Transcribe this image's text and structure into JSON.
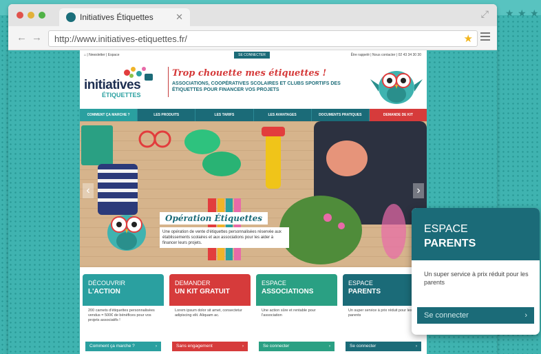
{
  "browser": {
    "tab_title": "Initiatives Étiquettes",
    "url": "http://www.initiatives-etiquettes.fr/"
  },
  "site": {
    "util_left": "| Newsletter | Espace",
    "util_connect": "SE CONNECTER",
    "util_right": "Être rappelé | Nous contacter | 02 43 34 30 30",
    "logo_main": "initiatives",
    "logo_sub": "ÉTIQUETTES",
    "tagline": "Trop chouette mes étiquettes !",
    "headline": "ASSOCIATIONS, COOPÉRATIVES SCOLAIRES ET CLUBS SPORTIFS DES ÉTIQUETTES POUR FINANCER VOS PROJETS",
    "nav": [
      "COMMENT ÇA MARCHE ?",
      "LES PRODUITS",
      "LES TARIFS",
      "LES AVANTAGES",
      "DOCUMENTS PRATIQUES",
      "DEMANDE DE KIT"
    ],
    "hero": {
      "title": "Opération Étiquettes",
      "text": "Une opération de vente d'étiquettes personnalisées réservée aux établissements scolaires et aux associations pour les aider à financer leurs projets."
    },
    "cards": [
      {
        "h1": "DÉCOUVRIR",
        "h2": "L'ACTION",
        "body": "200 carnets d'étiquettes personnalisées vendus = 500€ de bénéfices pour vos projets associatifs !",
        "button": "Comment ça marche ?",
        "color": "#2aa0a0"
      },
      {
        "h1": "DEMANDER",
        "h2": "UN KIT GRATUIT",
        "body": "Lorem ipsum dolor sit amet, consectetur adipiscing elit. Aliquam ac.",
        "button": "Sans engagement",
        "color": "#d63b3b"
      },
      {
        "h1": "ESPACE",
        "h2": "ASSOCIATIONS",
        "body": "Une action sûre et rentable pour l'association",
        "button": "Se connecter",
        "color": "#2aa083"
      },
      {
        "h1": "ESPACE",
        "h2": "PARENTS",
        "body": "Un super service à prix réduit pour les parents",
        "button": "Se connecter",
        "color": "#1b6b78"
      }
    ]
  },
  "popup": {
    "h1": "ESPACE",
    "h2": "PARENTS",
    "body": "Un super service à prix réduit pour les parents",
    "button": "Se connecter"
  }
}
